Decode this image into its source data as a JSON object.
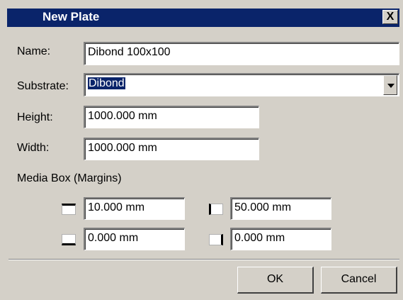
{
  "window": {
    "title": "New Plate",
    "close_label": "X"
  },
  "form": {
    "name_label": "Name:",
    "name_value": "Dibond 100x100",
    "substrate_label": "Substrate:",
    "substrate_value": "Dibond",
    "height_label": "Height:",
    "height_value": "1000.000 mm",
    "width_label": "Width:",
    "width_value": "1000.000 mm"
  },
  "media_box": {
    "label": "Media Box (Margins)",
    "top_value": "10.000 mm",
    "left_value": "50.000 mm",
    "bottom_value": "0.000 mm",
    "right_value": "0.000 mm"
  },
  "buttons": {
    "ok_label": "OK",
    "cancel_label": "Cancel"
  },
  "colors": {
    "titlebar": "#0a246a",
    "dialog_bg": "#d4d0c8",
    "selection": "#0a246a"
  },
  "icons": [
    "close-icon",
    "dropdown-arrow-icon",
    "margin-top-icon",
    "margin-left-icon",
    "margin-bottom-icon",
    "margin-right-icon"
  ]
}
